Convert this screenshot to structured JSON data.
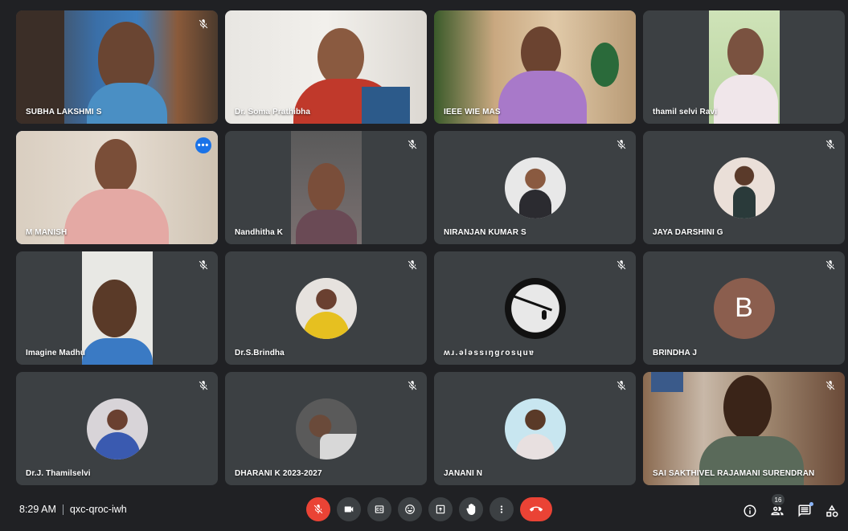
{
  "meeting": {
    "time": "8:29 AM",
    "code": "qxc-qroc-iwh"
  },
  "participants": [
    {
      "name": "SUBHA LAKSHMI S",
      "muted": true,
      "kind": "video"
    },
    {
      "name": "Dr. Soma Prathibha",
      "muted": false,
      "kind": "video"
    },
    {
      "name": "IEEE WIE MAS",
      "muted": false,
      "kind": "video"
    },
    {
      "name": "thamil selvi Ravi",
      "muted": false,
      "kind": "video"
    },
    {
      "name": "M MANISH",
      "muted": false,
      "kind": "video",
      "active": true
    },
    {
      "name": "Nandhitha K",
      "muted": true,
      "kind": "video"
    },
    {
      "name": "NIRANJAN KUMAR S",
      "muted": true,
      "kind": "avatar"
    },
    {
      "name": "JAYA DARSHINI G",
      "muted": true,
      "kind": "avatar"
    },
    {
      "name": "Imagine Madhu",
      "muted": true,
      "kind": "video"
    },
    {
      "name": "Dr.S.Brindha",
      "muted": true,
      "kind": "avatar"
    },
    {
      "name": "ʍɹ.ǝlǝssıŋɡɾosɥuɐ",
      "muted": true,
      "kind": "avatar"
    },
    {
      "name": "BRINDHA J",
      "muted": true,
      "kind": "letter",
      "letter": "B"
    },
    {
      "name": "Dr.J. Thamilselvi",
      "muted": true,
      "kind": "avatar"
    },
    {
      "name": "DHARANI K 2023-2027",
      "muted": true,
      "kind": "avatar"
    },
    {
      "name": "JANANI N",
      "muted": true,
      "kind": "avatar"
    },
    {
      "name": "SAI SAKTHIVEL RAJAMANI SURENDRAN",
      "muted": true,
      "kind": "video"
    }
  ],
  "people_count": "16",
  "colors": {
    "background": "#202124",
    "tile": "#3c4043",
    "end_call": "#ea4335",
    "active_outline": "#8ab4f8",
    "letter_avatar": "#8b5e4e"
  },
  "icons": {
    "controls": [
      "mic-off-icon",
      "camera-icon",
      "captions-icon",
      "emoji-icon",
      "present-icon",
      "raise-hand-icon",
      "more-options-icon",
      "end-call-icon"
    ],
    "right": [
      "info-icon",
      "people-icon",
      "chat-icon",
      "activities-icon"
    ]
  }
}
